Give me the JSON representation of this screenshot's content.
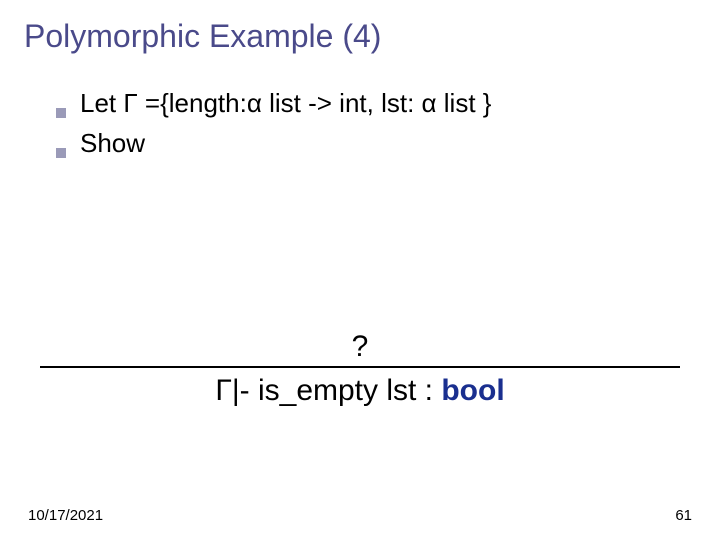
{
  "title": "Polymorphic Example (4)",
  "bullets": [
    {
      "text": "Let  Γ ={length:α list -> int,  lst: α list }"
    },
    {
      "text": "Show"
    }
  ],
  "proof": {
    "premise": "?",
    "conclusion_prefix": "Γ|- is_empty lst : ",
    "conclusion_type": "bool"
  },
  "footer": {
    "date": "10/17/2021",
    "page": "61"
  }
}
